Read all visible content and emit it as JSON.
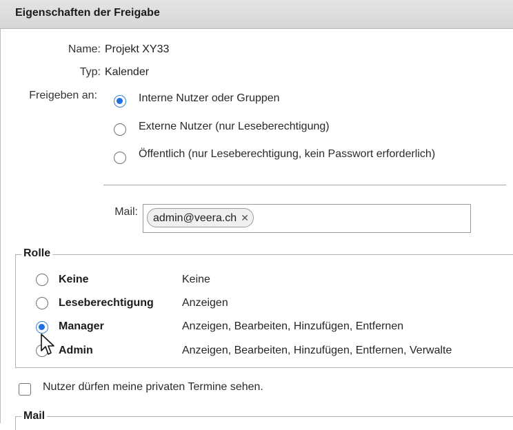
{
  "window": {
    "title": "Eigenschaften der Freigabe"
  },
  "properties": {
    "name_label": "Name:",
    "name_value": "Projekt XY33",
    "type_label": "Typ:",
    "type_value": "Kalender",
    "share_label": "Freigeben an:"
  },
  "share_options": [
    {
      "label": "Interne Nutzer oder Gruppen",
      "checked": true
    },
    {
      "label": "Externe Nutzer (nur Leseberechtigung)",
      "checked": false
    },
    {
      "label": "Öffentlich (nur Leseberechtigung, kein Passwort erforderlich)",
      "checked": false
    }
  ],
  "mail": {
    "label": "Mail:",
    "recipients": [
      "admin@veera.ch"
    ],
    "remove_icon": "close-icon"
  },
  "roles": {
    "legend": "Rolle",
    "items": [
      {
        "name": "Keine",
        "desc": "Keine",
        "checked": false
      },
      {
        "name": "Leseberechtigung",
        "desc": "Anzeigen",
        "checked": false
      },
      {
        "name": "Manager",
        "desc": "Anzeigen, Bearbeiten, Hinzufügen, Entfernen",
        "checked": true
      },
      {
        "name": "Admin",
        "desc": "Anzeigen, Bearbeiten, Hinzufügen, Entfernen, Verwalte",
        "checked": false
      }
    ]
  },
  "private_events": {
    "label": "Nutzer dürfen meine privaten Termine sehen.",
    "checked": false
  },
  "mail_section": {
    "legend": "Mail"
  },
  "colors": {
    "accent": "#1f6fe0",
    "titlebar": "#dcdcdc"
  }
}
